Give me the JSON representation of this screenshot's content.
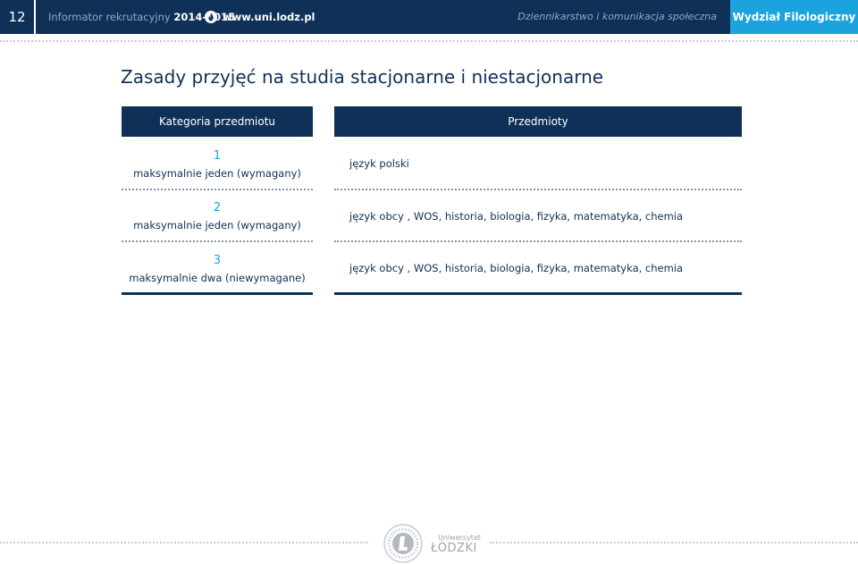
{
  "header": {
    "page_number": "12",
    "info_label": "Informator rekrutacyjny",
    "year": "2014-2015",
    "website": "www.uni.lodz.pl",
    "department": "Dziennikarstwo i komunikacja społeczna",
    "faculty": "Wydział Filologiczny",
    "colors": {
      "navy": "#0f3158",
      "accent": "#1aa3dd"
    }
  },
  "title": "Zasady przyjęć na studia stacjonarne i niestacjonarne",
  "table": {
    "headers": [
      "Kategoria przedmiotu",
      "Przedmioty"
    ],
    "rows": [
      {
        "num": "1",
        "category": "maksymalnie jeden (wymagany)",
        "subjects": "język polski"
      },
      {
        "num": "2",
        "category": "maksymalnie jeden (wymagany)",
        "subjects": "język obcy , WOS, historia, biologia, fizyka, matematyka, chemia"
      },
      {
        "num": "3",
        "category": "maksymalnie dwa (niewymagane)",
        "subjects": "język obcy , WOS, historia, biologia, fizyka, matematyka, chemia"
      }
    ]
  },
  "footer": {
    "logo_small": "Uniwersytet",
    "logo_big": "ŁÓDZKI",
    "seal_icon": "university-seal-icon"
  }
}
